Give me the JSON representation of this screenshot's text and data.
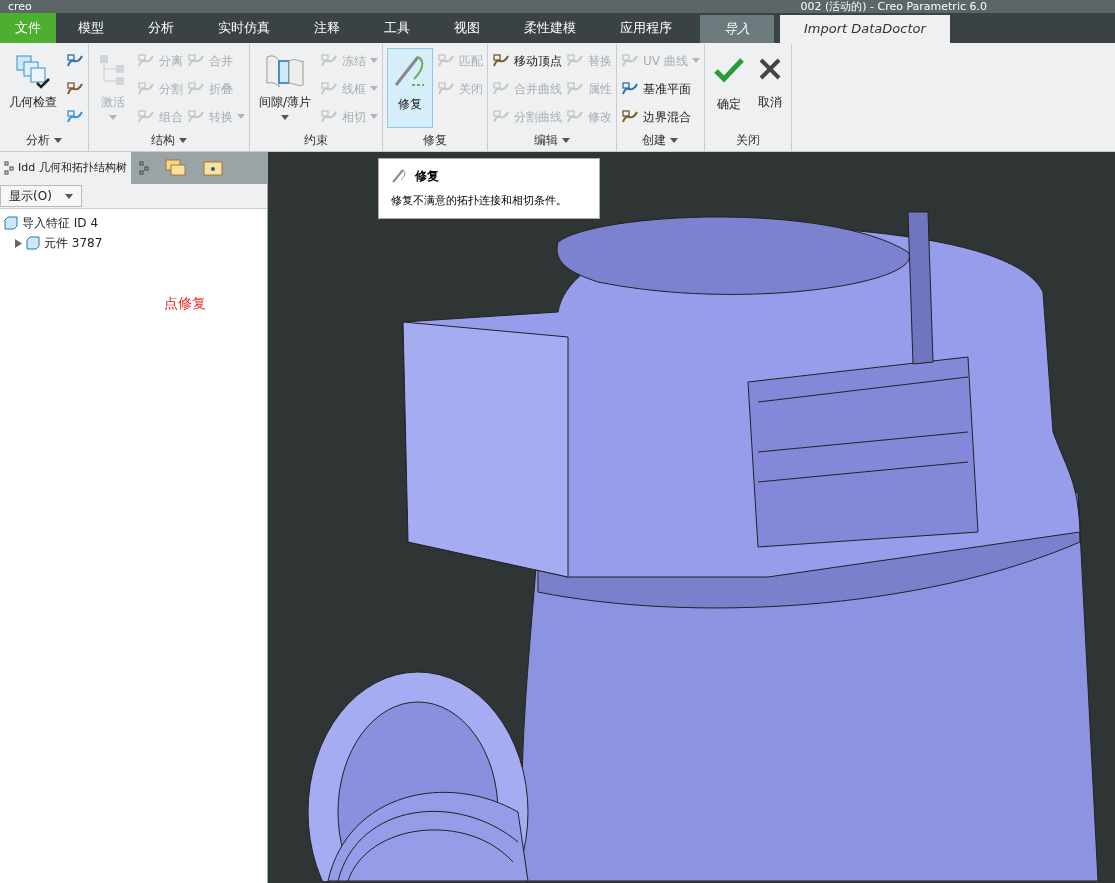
{
  "title_bar": {
    "logo": "creo",
    "title": "002 (活动的) - Creo Parametric 6.0"
  },
  "tabs": [
    {
      "label": "文件",
      "kind": "file",
      "selected": false
    },
    {
      "label": "模型",
      "kind": "normal",
      "selected": false
    },
    {
      "label": "分析",
      "kind": "normal",
      "selected": false
    },
    {
      "label": "实时仿真",
      "kind": "normal",
      "selected": false
    },
    {
      "label": "注释",
      "kind": "normal",
      "selected": false
    },
    {
      "label": "工具",
      "kind": "normal",
      "selected": false
    },
    {
      "label": "视图",
      "kind": "normal",
      "selected": false
    },
    {
      "label": "柔性建模",
      "kind": "normal",
      "selected": false
    },
    {
      "label": "应用程序",
      "kind": "normal",
      "selected": false
    },
    {
      "label": "导入",
      "kind": "context",
      "selected": false
    },
    {
      "label": "Import DataDoctor",
      "kind": "context",
      "selected": true
    }
  ],
  "ribbon": [
    {
      "label": "分析",
      "has_menu": true,
      "big": [
        {
          "label": "几何检查",
          "disabled": false,
          "selected": false,
          "has_menu": false
        }
      ],
      "small_columns": [
        [
          {
            "kind": "icon",
            "disabled": false
          },
          {
            "kind": "icon",
            "disabled": false
          },
          {
            "kind": "icon",
            "disabled": false
          }
        ]
      ]
    },
    {
      "label": "结构",
      "has_menu": true,
      "big": [
        {
          "label": "激活",
          "disabled": true,
          "selected": false,
          "has_menu": true
        }
      ],
      "small_columns": [
        [
          {
            "kind": "labeled",
            "label": "分离",
            "disabled": true,
            "has_menu": false
          },
          {
            "kind": "labeled",
            "label": "分割",
            "disabled": true,
            "has_menu": false
          },
          {
            "kind": "labeled",
            "label": "组合",
            "disabled": true,
            "has_menu": false
          }
        ],
        [
          {
            "kind": "labeled",
            "label": "合并",
            "disabled": true,
            "has_menu": false
          },
          {
            "kind": "labeled",
            "label": "折叠",
            "disabled": true,
            "has_menu": false
          },
          {
            "kind": "labeled",
            "label": "转换",
            "disabled": true,
            "has_menu": true
          }
        ]
      ]
    },
    {
      "label": "约束",
      "has_menu": false,
      "big": [
        {
          "label": "间隙/薄片",
          "disabled": false,
          "selected": false,
          "has_menu": true
        }
      ],
      "small_columns": [
        [
          {
            "kind": "labeled",
            "label": "冻结",
            "disabled": true,
            "has_menu": true
          },
          {
            "kind": "labeled",
            "label": "线框",
            "disabled": true,
            "has_menu": true
          },
          {
            "kind": "labeled",
            "label": "相切",
            "disabled": true,
            "has_menu": true
          }
        ]
      ]
    },
    {
      "label": "修复",
      "has_menu": false,
      "big": [
        {
          "label": "修复",
          "disabled": false,
          "selected": true,
          "has_menu": false
        }
      ],
      "small_columns": [
        [
          {
            "kind": "labeled",
            "label": "匹配",
            "disabled": true,
            "has_menu": false
          },
          {
            "kind": "labeled",
            "label": "关闭",
            "disabled": true,
            "has_menu": false
          }
        ]
      ]
    },
    {
      "label": "编辑",
      "has_menu": true,
      "small_columns": [
        [
          {
            "kind": "labeled",
            "label": "移动顶点",
            "disabled": false,
            "has_menu": false
          },
          {
            "kind": "labeled",
            "label": "合并曲线",
            "disabled": true,
            "has_menu": false
          },
          {
            "kind": "labeled",
            "label": "分割曲线",
            "disabled": true,
            "has_menu": false
          }
        ],
        [
          {
            "kind": "labeled",
            "label": "替换",
            "disabled": true,
            "has_menu": false
          },
          {
            "kind": "labeled",
            "label": "属性",
            "disabled": true,
            "has_menu": false
          },
          {
            "kind": "labeled",
            "label": "修改",
            "disabled": true,
            "has_menu": false
          }
        ]
      ]
    },
    {
      "label": "创建",
      "has_menu": true,
      "small_columns": [
        [
          {
            "kind": "labeled",
            "label": "UV 曲线",
            "disabled": true,
            "has_menu": true
          },
          {
            "kind": "labeled",
            "label": "基准平面",
            "disabled": false,
            "has_menu": false
          },
          {
            "kind": "labeled",
            "label": "边界混合",
            "disabled": false,
            "has_menu": false
          }
        ]
      ]
    },
    {
      "label": "关闭",
      "has_menu": false,
      "big": [
        {
          "label": "确定",
          "disabled": false,
          "selected": false,
          "has_menu": false
        },
        {
          "label": "取消",
          "disabled": false,
          "selected": false,
          "has_menu": false
        }
      ]
    }
  ],
  "panel": {
    "tabs": [
      {
        "label": "Idd 几何和拓扑结构树",
        "kind": "text",
        "selected": true
      },
      {
        "kind": "tree",
        "selected": false
      },
      {
        "kind": "folders",
        "selected": false
      }
    ],
    "display_menu": "显示(O)",
    "tree": [
      {
        "label": "导入特征 ID 4",
        "children": [
          {
            "label": "元件 3787",
            "expanded": false
          }
        ]
      }
    ],
    "note": "点修复"
  },
  "tooltip": {
    "title": "修复",
    "text": "修复不满意的拓扑连接和相切条件。"
  }
}
